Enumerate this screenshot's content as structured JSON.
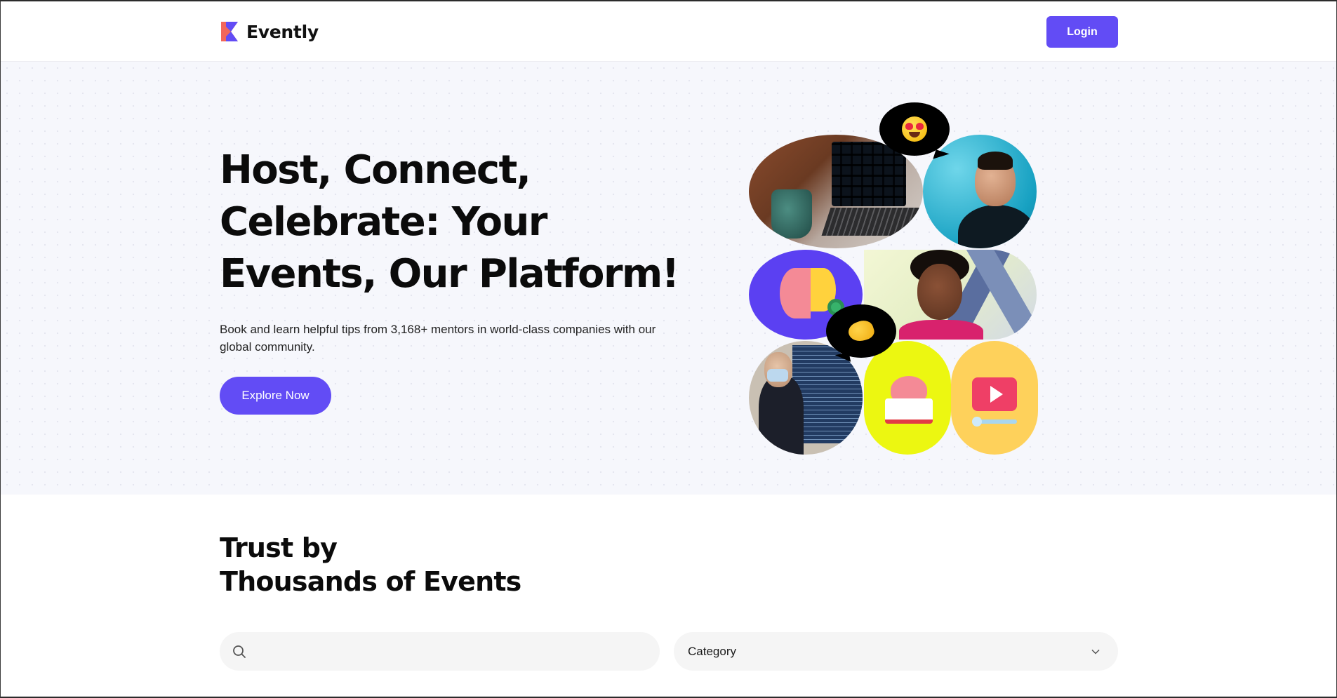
{
  "header": {
    "brand": "Evently",
    "login_label": "Login"
  },
  "hero": {
    "title_lines": [
      "Host, Connect,",
      "Celebrate: Your",
      "Events, Our Platform!"
    ],
    "subtitle": "Book and learn helpful tips from 3,168+ mentors in world-class companies with our global community.",
    "cta_label": "Explore Now"
  },
  "trust": {
    "title_lines": [
      "Trust by",
      "Thousands of Events"
    ]
  },
  "filters": {
    "search_value": "",
    "search_placeholder": "",
    "category_selected": "Category"
  },
  "icons": {
    "logo": "evently-logo-mark",
    "search": "search-icon",
    "category_toggle": "chevron-down-icon",
    "bubble_1": "heart-eyes-emoji",
    "bubble_2": "pinched-hand-emoji"
  },
  "colors": {
    "primary": "#624cf5",
    "logo_coral": "#f2665a",
    "hero_background": "#f6f7fc",
    "input_background": "#f5f5f5",
    "idea_tile": "#5b40f2",
    "book_tile": "#ecf711",
    "video_tile": "#fed15b",
    "man_tile": "#17a1c2"
  }
}
